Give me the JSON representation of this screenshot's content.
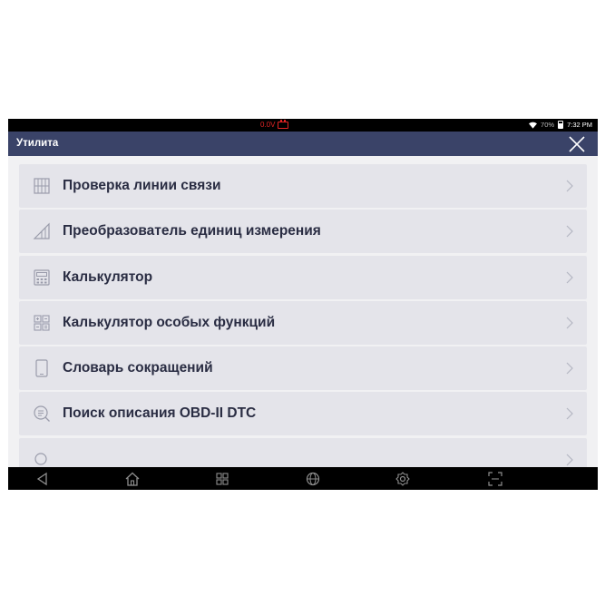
{
  "status": {
    "voltage": "0.0V",
    "battery_percent": "70%",
    "time": "7:32 PM"
  },
  "header": {
    "title": "Утилита"
  },
  "items": [
    {
      "label": "Проверка линии связи",
      "icon": "line-check-icon"
    },
    {
      "label": "Преобразователь единиц измерения",
      "icon": "unit-converter-icon"
    },
    {
      "label": "Калькулятор",
      "icon": "calculator-icon"
    },
    {
      "label": "Калькулятор особых функций",
      "icon": "special-calculator-icon"
    },
    {
      "label": "Словарь сокращений",
      "icon": "tablet-icon"
    },
    {
      "label": "Поиск описания OBD-II DTC",
      "icon": "search-doc-icon"
    }
  ],
  "nav": [
    "back-icon",
    "home-icon",
    "recent-apps-icon",
    "browser-icon",
    "settings-icon",
    "screenshot-icon"
  ],
  "colors": {
    "titlebar": "#3a4368",
    "list_item_bg": "#e4e4ea",
    "label_text": "#2a2d43",
    "voltage_warning": "#e02424"
  }
}
